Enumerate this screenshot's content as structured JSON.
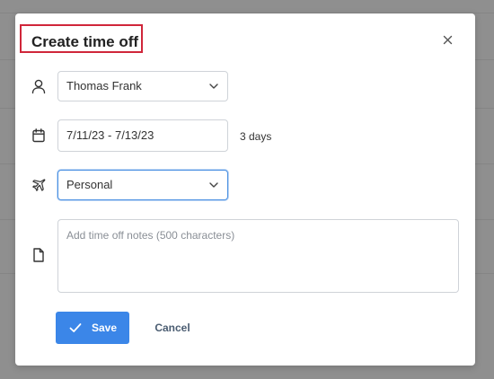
{
  "dialog": {
    "title": "Create time off",
    "close_icon": "close-icon"
  },
  "form": {
    "person": {
      "icon": "user-icon",
      "selected": "Thomas Frank"
    },
    "dates": {
      "icon": "calendar-icon",
      "value": "7/11/23 - 7/13/23",
      "duration": "3 days"
    },
    "type": {
      "icon": "airplane-icon",
      "selected": "Personal"
    },
    "notes": {
      "icon": "document-icon",
      "placeholder": "Add time off notes (500 characters)",
      "value": ""
    }
  },
  "actions": {
    "save_label": "Save",
    "save_icon": "check-icon",
    "cancel_label": "Cancel"
  },
  "colors": {
    "primary": "#3b86e8",
    "highlight_border": "#d0263a",
    "focus_border": "#4a90e2"
  }
}
